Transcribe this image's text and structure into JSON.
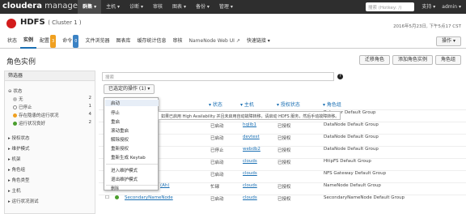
{
  "app": {
    "logo_bold": "cloudera",
    "logo_rest": "manager"
  },
  "nav": {
    "items": [
      "群集",
      "主机",
      "诊断",
      "审核",
      "图表",
      "备份",
      "管理"
    ],
    "search_placeholder": "搜索 (Hotkey: /)",
    "support": "支持",
    "user": "admin"
  },
  "cluster": {
    "name": "HDFS",
    "cluster_label": "( Cluster 1 )",
    "datetime": "2016年5月23日, 下午5点17 CST",
    "status_color": "#d31c1c"
  },
  "subtabs": [
    {
      "label": "状态"
    },
    {
      "label": "实例"
    },
    {
      "label": "配置",
      "badge": "3"
    },
    {
      "label": "命令",
      "badge": "0"
    },
    {
      "label": "文件浏览器"
    },
    {
      "label": "图表库"
    },
    {
      "label": "缓存统计信息"
    },
    {
      "label": "审核"
    },
    {
      "label": "NameNode Web UI"
    },
    {
      "label": "快速链接"
    }
  ],
  "ops_label": "操作",
  "page": {
    "title": "角色实例",
    "buttons": [
      "迁移角色",
      "添加角色实例",
      "角色组"
    ]
  },
  "sidebar": {
    "header": "筛选器",
    "status_label": "状态",
    "status_items": [
      {
        "label": "无",
        "count": "2",
        "color": "#bbbbbb"
      },
      {
        "label": "已停止",
        "count": "1",
        "color": "#ffffff"
      },
      {
        "label": "存在隐患的运行状况",
        "count": "4",
        "color": "#f0a020"
      },
      {
        "label": "运行状况良好",
        "count": "2",
        "color": "#4a9e2d"
      }
    ],
    "groups": [
      "授权状态",
      "维护模式",
      "机架",
      "角色组",
      "角色类型",
      "主机",
      "运行状况测试"
    ]
  },
  "main": {
    "search_placeholder": "搜索",
    "help_icon": "?",
    "selected_actions": "已选定的操作 (1)"
  },
  "dropdown": {
    "items": [
      "启动",
      "停止",
      "重启",
      "滚动重启",
      "解除授权",
      "重新授权",
      "重新生成 Keytab",
      "进入维护模式",
      "退出维护模式",
      "删除"
    ],
    "tooltip": "如果已启用 High Availability 并且未启用自动故障转移，请启动 HDFS 服务，然后手动故障转移。"
  },
  "table": {
    "headers": [
      "状态",
      "主机",
      "授权状态",
      "角色组"
    ],
    "rows": [
      {
        "state": "",
        "host": "",
        "auth": "",
        "group": "Balancer Default Group"
      },
      {
        "state": "已启动",
        "host": "hqlib1",
        "auth": "已授权",
        "group": "DataNode Default Group"
      },
      {
        "state": "已启动",
        "host": "devtest",
        "auth": "已授权",
        "group": "DataNode Default Group"
      },
      {
        "state": "已停止",
        "host": "webdb2",
        "auth": "已授权",
        "group": "DataNode Default Group"
      },
      {
        "state": "已启动",
        "host": "clouds",
        "auth": "已授权",
        "group": "HttpFS Default Group"
      },
      {
        "state": "已启动",
        "host": "clouds",
        "auth": "",
        "group": "NFS Gateway Default Group"
      },
      {
        "role": "(Ah)",
        "state": "忙碌",
        "host": "clouds",
        "auth": "已授权",
        "group": "NameNode Default Group"
      },
      {
        "role": "SecondaryNameNode",
        "state": "已启动",
        "host": "clouds",
        "auth": "已授权",
        "group": "SecondaryNameNode Default Group"
      }
    ]
  }
}
